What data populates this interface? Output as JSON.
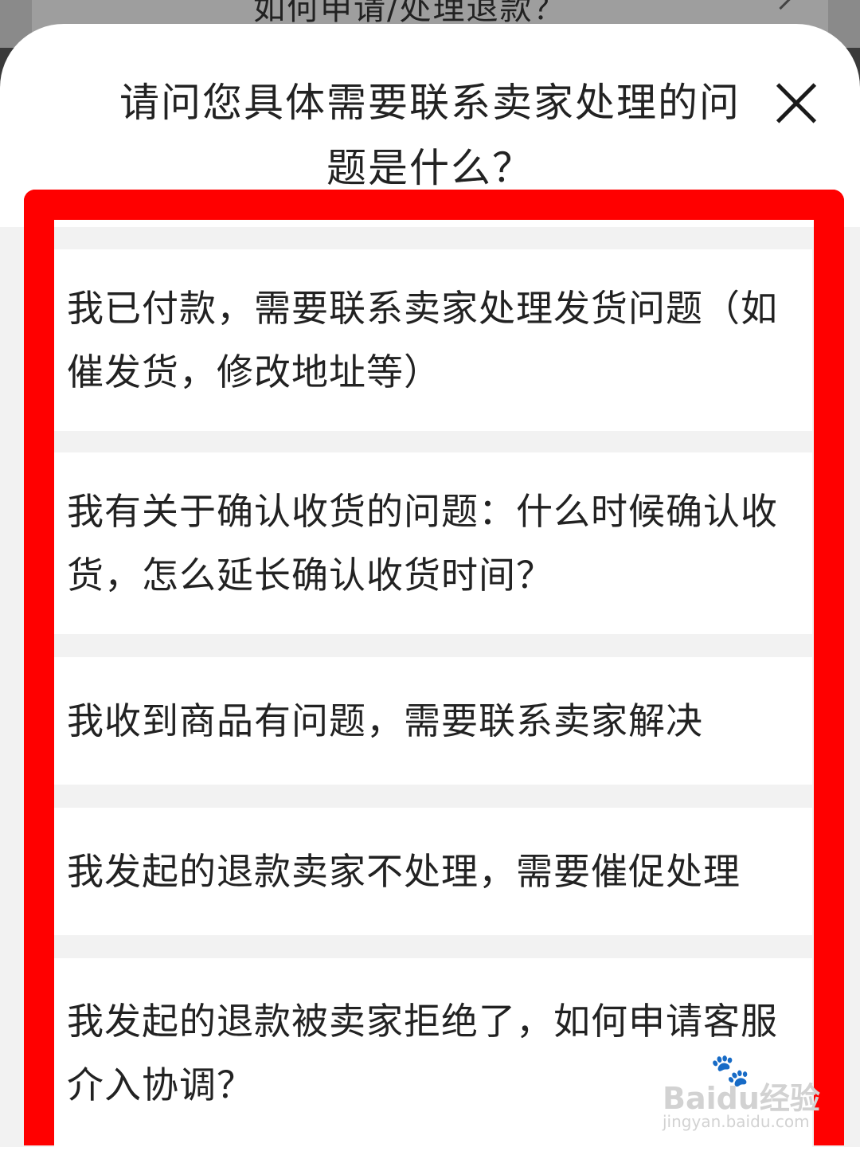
{
  "background": {
    "faq_item": "如何申请/处理退款？"
  },
  "dialog": {
    "title": "请问您具体需要联系卖家处理的问题是什么？",
    "close_icon": "close-icon"
  },
  "options": [
    "我已付款，需要联系卖家处理发货问题（如催发货，修改地址等）",
    "我有关于确认收货的问题：什么时候确认收货，怎么延长确认收货时间？",
    "我收到商品有问题，需要联系卖家解决",
    "我发起的退款卖家不处理，需要催促处理",
    "我发起的退款被卖家拒绝了，如何申请客服介入协调？"
  ],
  "watermark": {
    "brand": "Baidu经验",
    "url": "jingyan.baidu.com"
  },
  "colors": {
    "highlight": "#ff0000",
    "sheet": "#ffffff",
    "divider": "#f2f2f2"
  }
}
